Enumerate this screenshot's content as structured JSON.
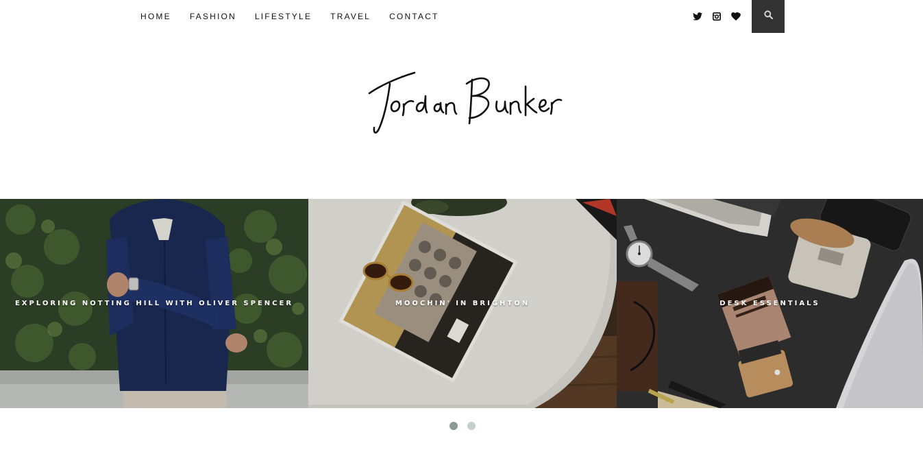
{
  "nav": {
    "items": [
      {
        "label": "HOME"
      },
      {
        "label": "FASHION"
      },
      {
        "label": "LIFESTYLE"
      },
      {
        "label": "TRAVEL"
      },
      {
        "label": "CONTACT"
      }
    ]
  },
  "social": {
    "icons": [
      "twitter-icon",
      "instagram-icon",
      "heart-icon"
    ]
  },
  "search": {
    "icon": "search-icon"
  },
  "logo": {
    "text": "Jordan Bunker"
  },
  "slider": {
    "slides": [
      {
        "title": "EXPLORING NOTTING HILL WITH OLIVER SPENCER"
      },
      {
        "title": "MOOCHIN' IN BRIGHTON"
      },
      {
        "title": "DESK ESSENTIALS"
      }
    ],
    "page_count": 2,
    "active_page": 1
  },
  "colors": {
    "search_bg": "#333333",
    "dot_active": "#8c9896",
    "dot_inactive": "#c7cfcd"
  }
}
